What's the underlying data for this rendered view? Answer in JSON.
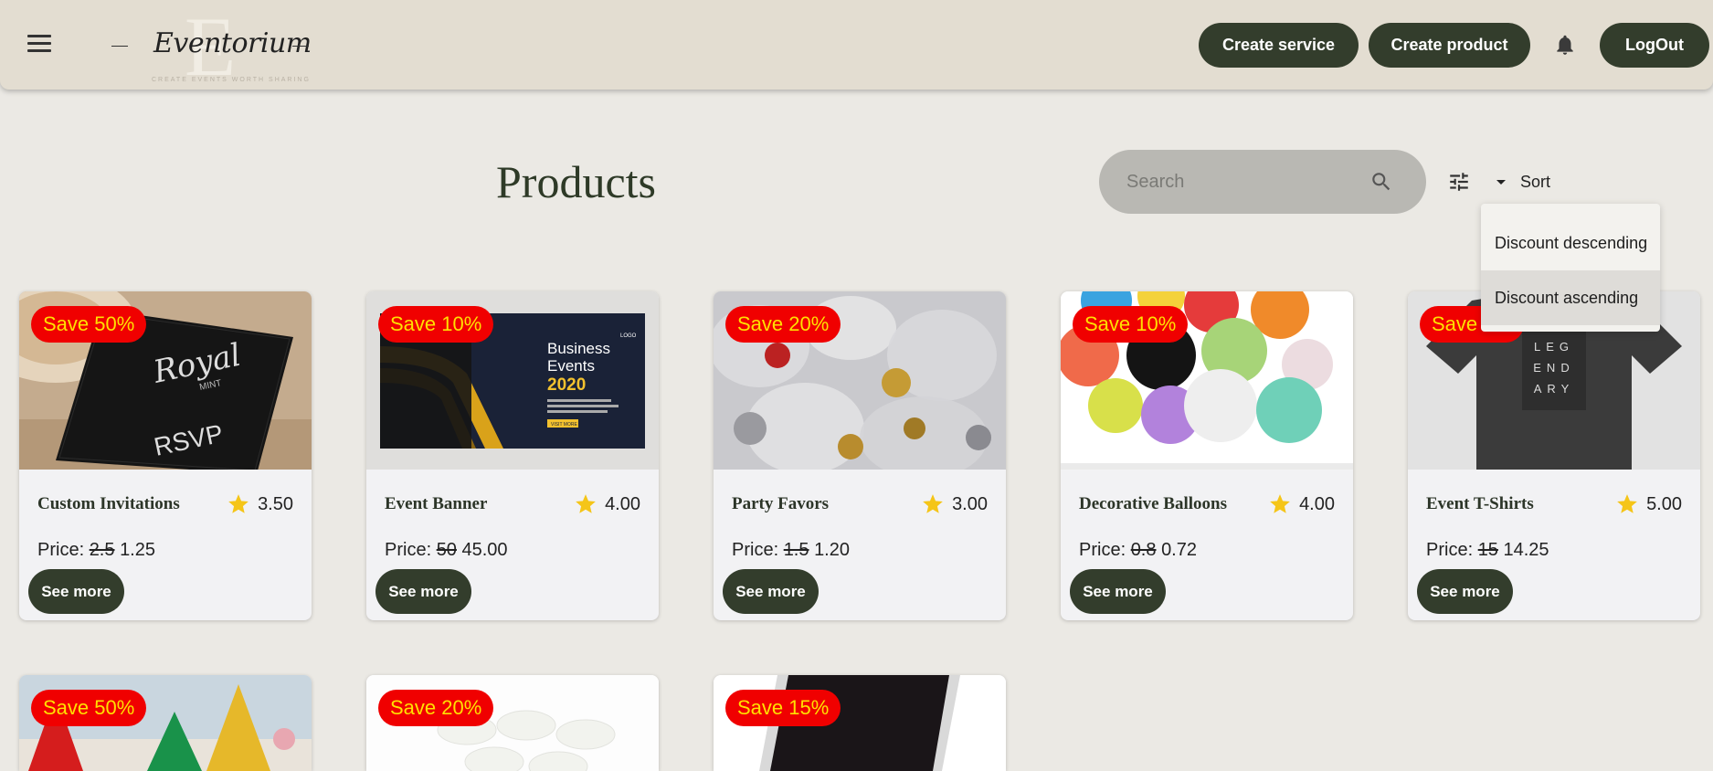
{
  "header": {
    "logo": {
      "name": "Eventorium",
      "tagline": "CREATE EVENTS WORTH SHARING"
    },
    "buttons": {
      "create_service": "Create service",
      "create_product": "Create product",
      "logout": "LogOut"
    },
    "icons": [
      "menu-icon",
      "bell-icon"
    ]
  },
  "main": {
    "title": "Products",
    "search": {
      "placeholder": "Search"
    },
    "sort": {
      "label": "Sort",
      "options": [
        "Discount descending",
        "Discount ascending"
      ],
      "highlighted": "Discount ascending"
    }
  },
  "products": [
    {
      "name": "Custom Invitations",
      "rating": "3.50",
      "price_label": "Price:",
      "old_price": "2.5",
      "new_price": "1.25",
      "discount": "Save 50%",
      "button": "See more"
    },
    {
      "name": "Event Banner",
      "rating": "4.00",
      "price_label": "Price:",
      "old_price": "50",
      "new_price": "45.00",
      "discount": "Save 10%",
      "button": "See more",
      "banner_text": {
        "line1": "Business",
        "line2": "Events",
        "year": "2020",
        "logo": "LOGO",
        "cta": "VISIT MORE"
      }
    },
    {
      "name": "Party Favors",
      "rating": "3.00",
      "price_label": "Price:",
      "old_price": "1.5",
      "new_price": "1.20",
      "discount": "Save 20%",
      "button": "See more"
    },
    {
      "name": "Decorative Balloons",
      "rating": "4.00",
      "price_label": "Price:",
      "old_price": "0.8",
      "new_price": "0.72",
      "discount": "Save 10%",
      "button": "See more"
    },
    {
      "name": "Event T-Shirts",
      "rating": "5.00",
      "price_label": "Price:",
      "old_price": "15",
      "new_price": "14.25",
      "discount": "Save 5%",
      "button": "See more"
    }
  ],
  "products_row2": [
    {
      "discount": "Save 50%"
    },
    {
      "discount": "Save 20%"
    },
    {
      "discount": "Save 15%"
    }
  ],
  "colors": {
    "header_bg": "#e3ddd1",
    "page_bg": "#ebe9e4",
    "button_bg": "#333d2c",
    "badge_bg": "#f00000",
    "badge_text": "#ffe000",
    "star": "#f5c518"
  }
}
